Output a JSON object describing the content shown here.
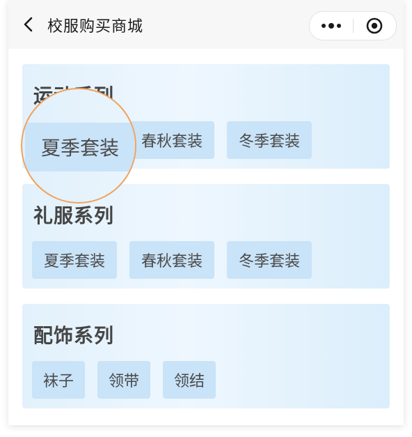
{
  "navbar": {
    "title": "校服购买商城",
    "back_icon": "chevron-left-icon",
    "more_icon": "more-dots-icon",
    "close_icon": "target-circle-icon"
  },
  "sections": [
    {
      "title": "运动系列",
      "items": [
        "夏季套装",
        "春秋套装",
        "冬季套装"
      ]
    },
    {
      "title": "礼服系列",
      "items": [
        "夏季套装",
        "春秋套装",
        "冬季套装"
      ]
    },
    {
      "title": "配饰系列",
      "items": [
        "袜子",
        "领带",
        "领结"
      ]
    }
  ],
  "magnifier": {
    "label": "夏季套装"
  },
  "colors": {
    "accent_ring": "#f0a25e",
    "tag_bg": "#c9e3f8",
    "section_bg": "#e6f3fd"
  }
}
